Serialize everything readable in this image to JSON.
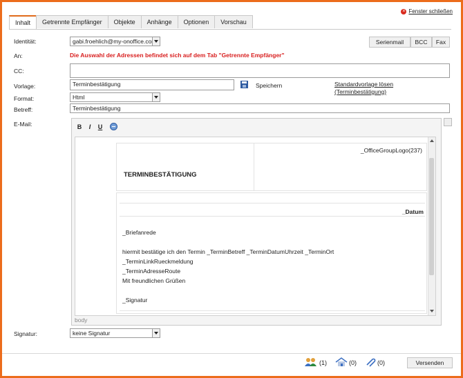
{
  "close_link": "Fenster schließen",
  "tabs": [
    "Inhalt",
    "Getrennte Empfänger",
    "Objekte",
    "Anhänge",
    "Optionen",
    "Vorschau"
  ],
  "labels": {
    "identitaet": "Identität:",
    "an": "An:",
    "cc": "CC:",
    "vorlage": "Vorlage:",
    "format": "Format:",
    "betreff": "Betreff:",
    "email": "E-Mail:",
    "signatur": "Signatur:"
  },
  "identity_value": "gabi.froehlich@my-onoffice.com",
  "an_warning": "Die Auswahl der Adressen befindet sich auf dem Tab \"Getrennte Empfänger\"",
  "top_buttons": [
    "Serienmail",
    "BCC",
    "Fax"
  ],
  "vorlage_value": "Terminbestätigung",
  "save_label": "Speichern",
  "standard_link_1": "Standardvorlage lösen",
  "standard_link_2": "(Terminbestätigung)",
  "format_value": "Html",
  "betreff_value": "Terminbestätigung",
  "editor": {
    "toolbar": [
      "B",
      "I",
      "U"
    ],
    "logo_placeholder": "_OfficeGroupLogo(237)",
    "heading": "TERMINBESTÄTIGUNG",
    "datum": "_Datum",
    "lines": [
      "_Briefanrede",
      "hiermit bestätige ich den Termin _TerminBetreff _TerminDatumUhrzeit _TerminOrt",
      "_TerminLinkRueckmeldung",
      "_TerminAdresseRoute",
      "Mit freundlichen Grüßen",
      "_Signatur"
    ],
    "status": "body"
  },
  "signatur_value": "keine Signatur",
  "footer": {
    "contacts_count": "(1)",
    "estates_count": "(0)",
    "attachments_count": "(0)",
    "send_label": "Versenden"
  },
  "colors": {
    "frame": "#ec6c1c",
    "warning": "#d81e1e",
    "active_tab": "#e06a1a"
  }
}
